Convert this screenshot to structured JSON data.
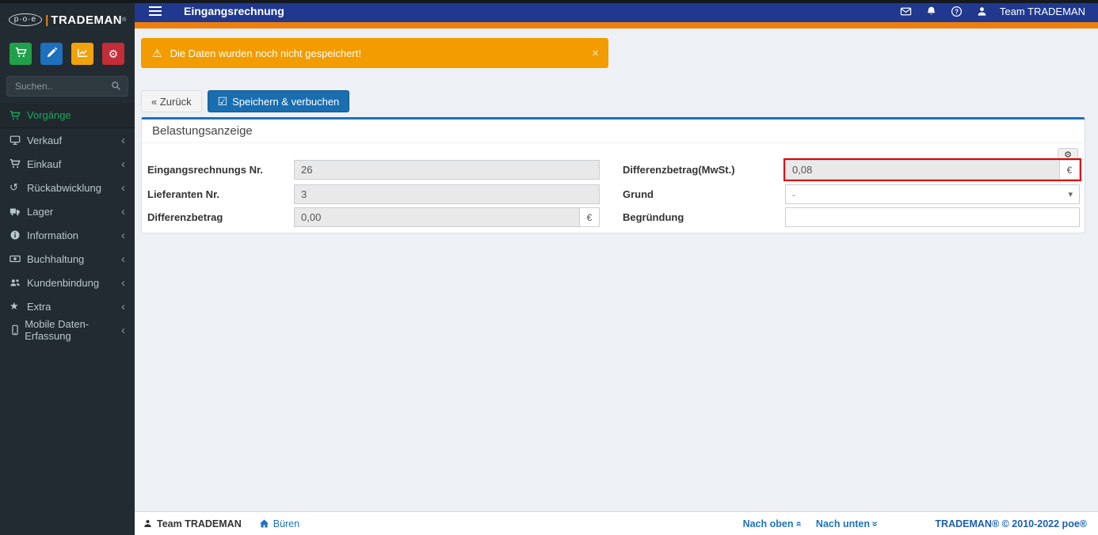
{
  "brand": {
    "poe": "p·o·e",
    "name": "TRADEMAN",
    "reg": "®"
  },
  "navbar": {
    "title": "Eingangsrechnung",
    "user": "Team TRADEMAN"
  },
  "sidebar": {
    "search_placeholder": "Suchen..",
    "menu": [
      {
        "label": "Vorgänge"
      },
      {
        "label": "Verkauf"
      },
      {
        "label": "Einkauf"
      },
      {
        "label": "Rückabwicklung"
      },
      {
        "label": "Lager"
      },
      {
        "label": "Information"
      },
      {
        "label": "Buchhaltung"
      },
      {
        "label": "Kundenbindung"
      },
      {
        "label": "Extra"
      },
      {
        "label": "Mobile Daten-Erfassung"
      }
    ]
  },
  "alert": {
    "text": "Die Daten wurden noch nicht gespeichert!"
  },
  "toolbar": {
    "back": "« Zurück",
    "save": "Speichern & verbuchen"
  },
  "panel": {
    "title": "Belastungsanzeige",
    "rows": [
      {
        "left": {
          "label": "Eingangsrechnungs Nr.",
          "value": "26"
        },
        "right": {
          "label": "Differenzbetrag(MwSt.)",
          "value": "0,08",
          "addon": "€"
        }
      },
      {
        "left": {
          "label": "Lieferanten Nr.",
          "value": "3"
        },
        "right": {
          "label": "Grund",
          "value": "-"
        }
      },
      {
        "left": {
          "label": "Differenzbetrag",
          "value": "0,00",
          "addon": "€"
        },
        "right": {
          "label": "Begründung",
          "value": ""
        }
      }
    ]
  },
  "footer": {
    "user": "Team TRADEMAN",
    "location": "Büren",
    "to_top": "Nach oben",
    "to_bottom": "Nach unten",
    "copyright": "TRADEMAN® © 2010-2022 poe®"
  },
  "icons": {
    "warning": "⚠",
    "close": "×",
    "check": "☑",
    "gear": "⚙",
    "caret_down": "▾",
    "chevron_left": "‹",
    "double_up": "«",
    "double_down": "»",
    "star": "★",
    "undo": "↺"
  },
  "colors": {
    "navbar": "#20398f",
    "navbar_accent": "#ee7f0d",
    "alert_bg": "#f29c00",
    "primary_btn": "#196eb0",
    "panel_accent": "#1d72b8",
    "highlight_red": "#e00000",
    "active_green": "#16a75c",
    "sidebar_bg": "#222b31",
    "link_blue": "#1e73be",
    "quick_green": "#21a04c",
    "quick_blue": "#1d70bd",
    "quick_orange": "#f2a20c",
    "quick_red": "#c22d38"
  }
}
